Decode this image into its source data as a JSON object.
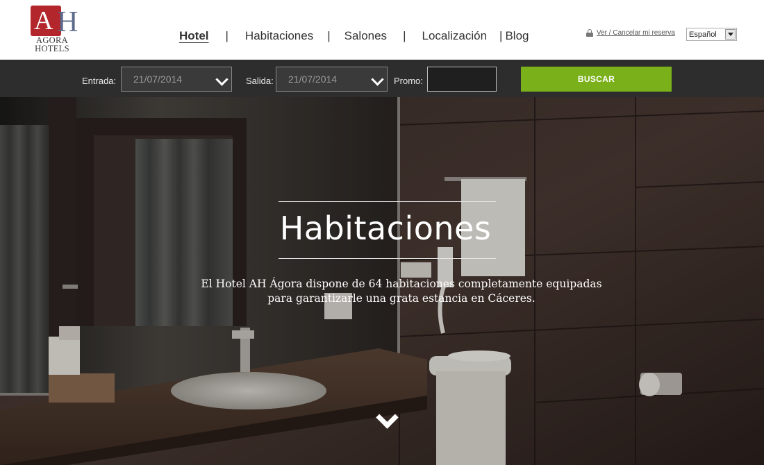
{
  "brand": {
    "mark": "A",
    "mark2": "H",
    "line1": "AGORA",
    "line2": "HOTELS",
    "color": "#b3262c"
  },
  "nav": {
    "items": [
      {
        "label": "Hotel",
        "active": true
      },
      {
        "label": "Habitaciones"
      },
      {
        "label": "Salones"
      },
      {
        "label": "Localización"
      },
      {
        "label": "Blog"
      }
    ],
    "separator": "|"
  },
  "account": {
    "icon": "lock-icon",
    "link": "Ver / Cancelar mi reserva"
  },
  "language": {
    "selected": "Español"
  },
  "booking": {
    "entrada_label": "Entrada:",
    "entrada_value": "21/07/2014",
    "salida_label": "Salida:",
    "salida_value": "21/07/2014",
    "promo_label": "Promo:",
    "promo_value": "",
    "search_label": "BUSCAR",
    "accent": "#7ab019"
  },
  "hero": {
    "title": "Habitaciones",
    "text_line1": "El Hotel AH Ágora dispone de 64 habitaciones completamente equipadas",
    "text_line2": "para garantizarle una grata estancia en Cáceres.",
    "scroll_icon": "chevron-down-icon"
  }
}
